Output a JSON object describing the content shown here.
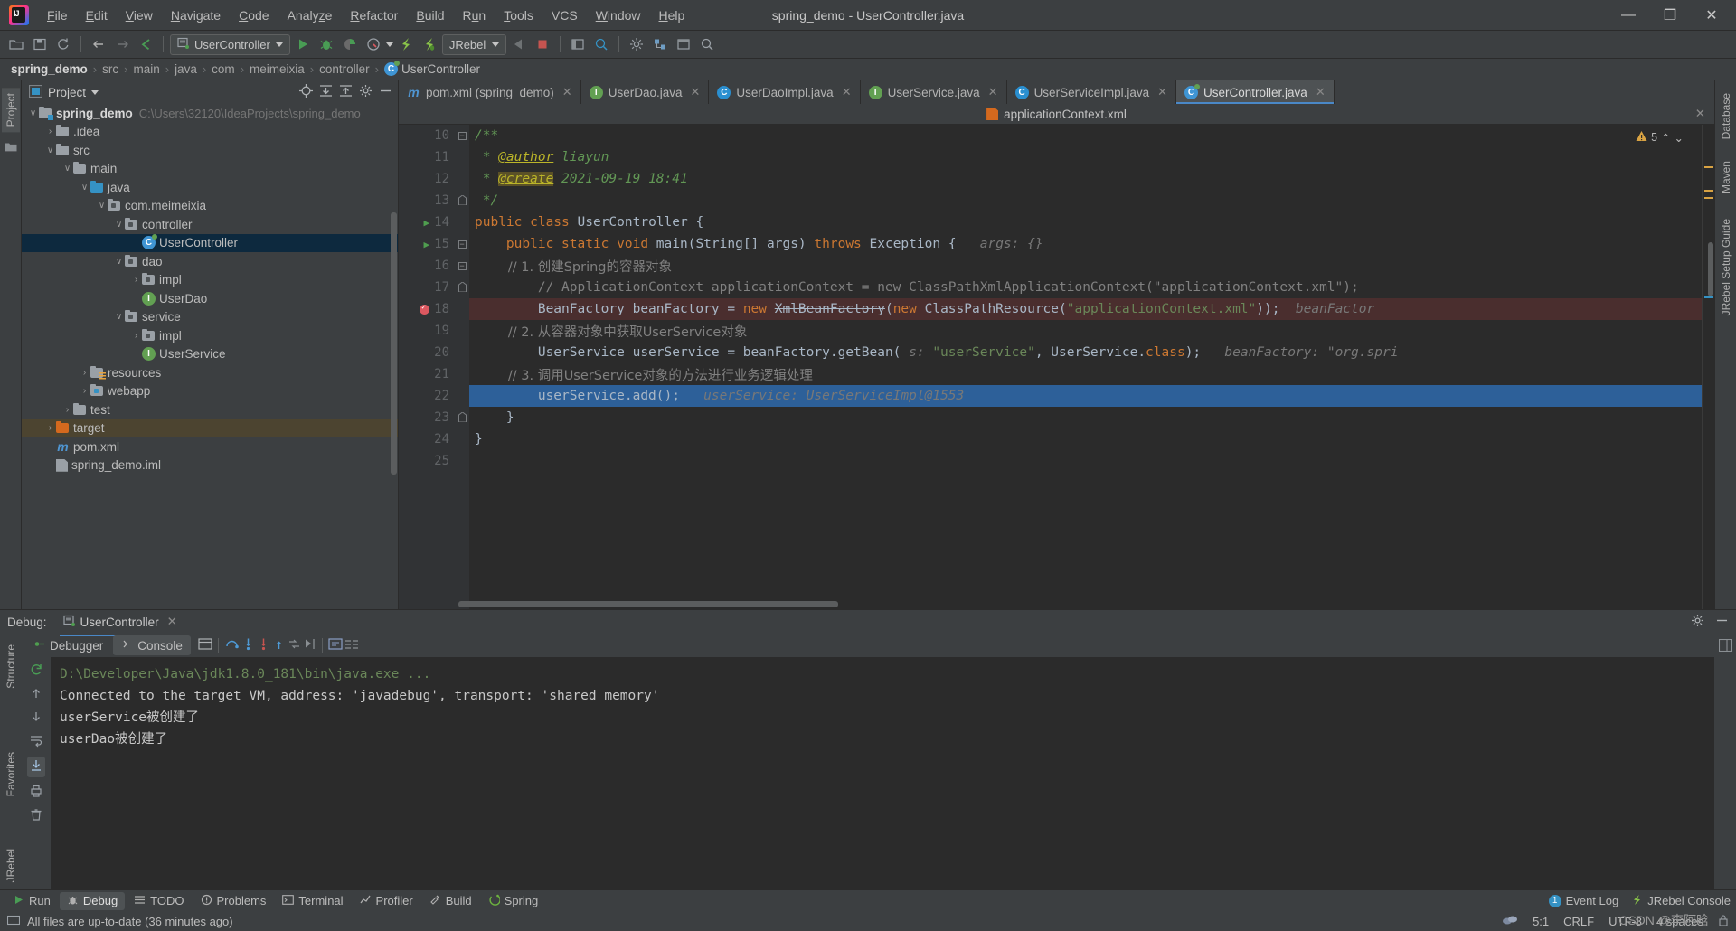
{
  "window": {
    "title": "spring_demo - UserController.java",
    "controls": {
      "minimize": "—",
      "maximize": "❐",
      "close": "✕"
    }
  },
  "menu": [
    {
      "label": "File"
    },
    {
      "label": "Edit"
    },
    {
      "label": "View"
    },
    {
      "label": "Navigate"
    },
    {
      "label": "Code"
    },
    {
      "label": "Analyze"
    },
    {
      "label": "Refactor"
    },
    {
      "label": "Build"
    },
    {
      "label": "Run"
    },
    {
      "label": "Tools"
    },
    {
      "label": "VCS"
    },
    {
      "label": "Window"
    },
    {
      "label": "Help"
    }
  ],
  "toolbar": {
    "run_config": "UserController",
    "jrebel": "JRebel",
    "icons": [
      "open-folder-icon",
      "save-icon",
      "sync-icon",
      "back-icon",
      "forward-icon",
      "run-icon",
      "debug-icon",
      "coverage-icon",
      "profile-icon",
      "jrebel-run-icon",
      "jrebel-debug-icon",
      "step-back-icon",
      "stop-icon",
      "layout-icon",
      "search-everywhere-icon",
      "settings-icon",
      "structure-icon",
      "preview-icon",
      "search-icon"
    ]
  },
  "breadcrumb": {
    "items": [
      "spring_demo",
      "src",
      "main",
      "java",
      "com",
      "meimeixia",
      "controller"
    ],
    "last": "UserController",
    "separator": "›"
  },
  "left_strip": {
    "tabs": [
      "Project"
    ]
  },
  "right_strip": {
    "tabs": [
      "Database",
      "Maven",
      "JRebel Setup Guide"
    ]
  },
  "project_panel": {
    "title": "Project",
    "tree": [
      {
        "indent": 0,
        "arrow": "∨",
        "icon": "project-folder-icon",
        "label": "spring_demo",
        "bold": true,
        "hint": "C:\\Users\\32120\\IdeaProjects\\spring_demo"
      },
      {
        "indent": 1,
        "arrow": "›",
        "icon": "folder-icon",
        "label": ".idea"
      },
      {
        "indent": 1,
        "arrow": "∨",
        "icon": "folder-icon",
        "label": "src"
      },
      {
        "indent": 2,
        "arrow": "∨",
        "icon": "folder-icon",
        "label": "main"
      },
      {
        "indent": 3,
        "arrow": "∨",
        "icon": "source-folder-icon",
        "label": "java"
      },
      {
        "indent": 4,
        "arrow": "∨",
        "icon": "package-icon",
        "label": "com.meimeixia"
      },
      {
        "indent": 5,
        "arrow": "∨",
        "icon": "package-icon",
        "label": "controller"
      },
      {
        "indent": 6,
        "arrow": "",
        "icon": "spring-class-icon",
        "label": "UserController",
        "selected": true
      },
      {
        "indent": 5,
        "arrow": "∨",
        "icon": "package-icon",
        "label": "dao"
      },
      {
        "indent": 6,
        "arrow": "›",
        "icon": "package-icon",
        "label": "impl"
      },
      {
        "indent": 6,
        "arrow": "",
        "icon": "interface-icon",
        "label": "UserDao"
      },
      {
        "indent": 5,
        "arrow": "∨",
        "icon": "package-icon",
        "label": "service"
      },
      {
        "indent": 6,
        "arrow": "›",
        "icon": "package-icon",
        "label": "impl"
      },
      {
        "indent": 6,
        "arrow": "",
        "icon": "interface-icon",
        "label": "UserService"
      },
      {
        "indent": 3,
        "arrow": "›",
        "icon": "resources-folder-icon",
        "label": "resources"
      },
      {
        "indent": 3,
        "arrow": "›",
        "icon": "webapp-icon",
        "label": "webapp"
      },
      {
        "indent": 2,
        "arrow": "›",
        "icon": "folder-icon",
        "label": "test"
      },
      {
        "indent": 1,
        "arrow": "›",
        "icon": "target-folder-icon",
        "label": "target",
        "highlight": true
      },
      {
        "indent": 1,
        "arrow": "",
        "icon": "maven-icon",
        "label": "pom.xml"
      },
      {
        "indent": 1,
        "arrow": "",
        "icon": "iml-icon",
        "label": "spring_demo.iml"
      }
    ]
  },
  "editor": {
    "tabs": [
      {
        "label": "pom.xml (spring_demo)",
        "icon": "maven-icon",
        "active": false
      },
      {
        "label": "UserDao.java",
        "icon": "interface-icon",
        "active": false
      },
      {
        "label": "UserDaoImpl.java",
        "icon": "class-icon",
        "active": false
      },
      {
        "label": "UserService.java",
        "icon": "interface-icon",
        "active": false
      },
      {
        "label": "UserServiceImpl.java",
        "icon": "class-icon",
        "active": false
      },
      {
        "label": "UserController.java",
        "icon": "spring-class-icon",
        "active": true
      }
    ],
    "context_file": "applicationContext.xml",
    "warnings": "5",
    "lines": [
      {
        "n": "10",
        "fold": "minus",
        "tokens": [
          {
            "t": "/**",
            "c": "doc"
          }
        ]
      },
      {
        "n": "11",
        "fold": "",
        "tokens": [
          {
            "t": " * ",
            "c": "doc"
          },
          {
            "t": "@author",
            "c": "doctag"
          },
          {
            "t": " liayun",
            "c": "doc"
          }
        ]
      },
      {
        "n": "12",
        "fold": "",
        "tokens": [
          {
            "t": " * ",
            "c": "doc"
          },
          {
            "t": "@create",
            "c": "doctag hilite"
          },
          {
            "t": " 2021-09-19 18:41",
            "c": "doc"
          }
        ]
      },
      {
        "n": "13",
        "fold": "end",
        "tokens": [
          {
            "t": " */",
            "c": "doc"
          }
        ]
      },
      {
        "n": "14",
        "gutter_icon": "run-gutter-icon",
        "fold": "",
        "tokens": [
          {
            "t": "public class ",
            "c": "kw"
          },
          {
            "t": "UserController {",
            "c": "ident"
          }
        ]
      },
      {
        "n": "15",
        "gutter_icon": "run-gutter-icon",
        "fold": "minus",
        "tokens": [
          {
            "t": "    public static void ",
            "c": "kw"
          },
          {
            "t": "main(String[] args) ",
            "c": "ident"
          },
          {
            "t": "throws ",
            "c": "kw"
          },
          {
            "t": "Exception {",
            "c": "ident"
          },
          {
            "t": "   args: {}",
            "c": "hint"
          }
        ]
      },
      {
        "n": "16",
        "fold": "minus",
        "tokens": [
          {
            "t": "        // 1. 创建Spring的容器对象",
            "c": "cmt"
          }
        ]
      },
      {
        "n": "17",
        "fold": "end",
        "tokens": [
          {
            "t": "        // ApplicationContext applicationContext = new ClassPathXmlApplicationContext(\"applicationContext.xml\");",
            "c": "cmt"
          }
        ]
      },
      {
        "n": "18",
        "gutter_icon": "breakpoint-icon",
        "row": "breakpoint",
        "tokens": [
          {
            "t": "        BeanFactory beanFactory = ",
            "c": "ident"
          },
          {
            "t": "new ",
            "c": "kw"
          },
          {
            "t": "XmlBeanFactory",
            "c": "strike"
          },
          {
            "t": "(",
            "c": "ident"
          },
          {
            "t": "new ",
            "c": "kw"
          },
          {
            "t": "ClassPathResource(",
            "c": "ident"
          },
          {
            "t": "\"applicationContext.xml\"",
            "c": "str"
          },
          {
            "t": "));",
            "c": "ident"
          },
          {
            "t": "  beanFactor",
            "c": "hint"
          }
        ]
      },
      {
        "n": "19",
        "fold": "",
        "tokens": [
          {
            "t": "        // 2. 从容器对象中获取UserService对象",
            "c": "cmt"
          }
        ]
      },
      {
        "n": "20",
        "fold": "",
        "tokens": [
          {
            "t": "        UserService userService = beanFactory.getBean(",
            "c": "ident"
          },
          {
            "t": " s: ",
            "c": "hint"
          },
          {
            "t": "\"userService\"",
            "c": "str"
          },
          {
            "t": ", UserService.",
            "c": "ident"
          },
          {
            "t": "class",
            "c": "kw"
          },
          {
            "t": ");",
            "c": "ident"
          },
          {
            "t": "   beanFactory: \"org.spri",
            "c": "hint"
          }
        ]
      },
      {
        "n": "21",
        "fold": "",
        "tokens": [
          {
            "t": "        // 3. 调用UserService对象的方法进行业务逻辑处理",
            "c": "cmt"
          }
        ]
      },
      {
        "n": "22",
        "row": "current",
        "tokens": [
          {
            "t": "        userService.add();",
            "c": "ident"
          },
          {
            "t": "   userService: UserServiceImpl@1553",
            "c": "hint"
          }
        ]
      },
      {
        "n": "23",
        "fold": "end",
        "tokens": [
          {
            "t": "    }",
            "c": "ident"
          }
        ]
      },
      {
        "n": "24",
        "fold": "",
        "tokens": [
          {
            "t": "}",
            "c": "ident"
          }
        ]
      },
      {
        "n": "25",
        "fold": "",
        "tokens": []
      }
    ]
  },
  "debug": {
    "label": "Debug:",
    "session_tab": "UserController",
    "close_icon": "✕",
    "subtabs": [
      {
        "label": "Debugger",
        "icon": "debugger-icon",
        "active": false
      },
      {
        "label": "Console",
        "icon": "console-icon",
        "active": true
      }
    ],
    "console_lines": [
      {
        "text": "D:\\Developer\\Java\\jdk1.8.0_181\\bin\\java.exe ...",
        "color": "green"
      },
      {
        "text": "Connected to the target VM, address: 'javadebug', transport: 'shared memory'",
        "color": "white"
      },
      {
        "text": "userService被创建了",
        "color": "white"
      },
      {
        "text": "userDao被创建了",
        "color": "white"
      }
    ],
    "left_tabs": [
      "Structure",
      "Favorites",
      "JRebel"
    ]
  },
  "bottom_tabs": [
    {
      "label": "Run",
      "icon": "run-icon",
      "active": false
    },
    {
      "label": "Debug",
      "icon": "debug-icon",
      "active": true
    },
    {
      "label": "TODO",
      "icon": "todo-icon",
      "active": false
    },
    {
      "label": "Problems",
      "icon": "problems-icon",
      "active": false
    },
    {
      "label": "Terminal",
      "icon": "terminal-icon",
      "active": false
    },
    {
      "label": "Profiler",
      "icon": "profiler-icon",
      "active": false
    },
    {
      "label": "Build",
      "icon": "build-icon",
      "active": false
    },
    {
      "label": "Spring",
      "icon": "spring-icon",
      "active": false
    }
  ],
  "bottom_right": {
    "event_log": "Event Log",
    "event_log_count": "1",
    "jrebel_console": "JRebel Console"
  },
  "status": {
    "message": "All files are up-to-date (36 minutes ago)",
    "caret": "5:1",
    "line_sep": "CRLF",
    "encoding": "UTF-8",
    "indent": "4 spaces",
    "watermark": "CSDN @李阿晗"
  },
  "colors": {
    "accent": "#4a88c7",
    "selection": "#2d6099",
    "tree_selection": "#0d293e",
    "breakpoint": "#4a2e2e",
    "keyword": "#cc7832",
    "string": "#6a8759",
    "comment": "#808080",
    "doc": "#629755"
  }
}
